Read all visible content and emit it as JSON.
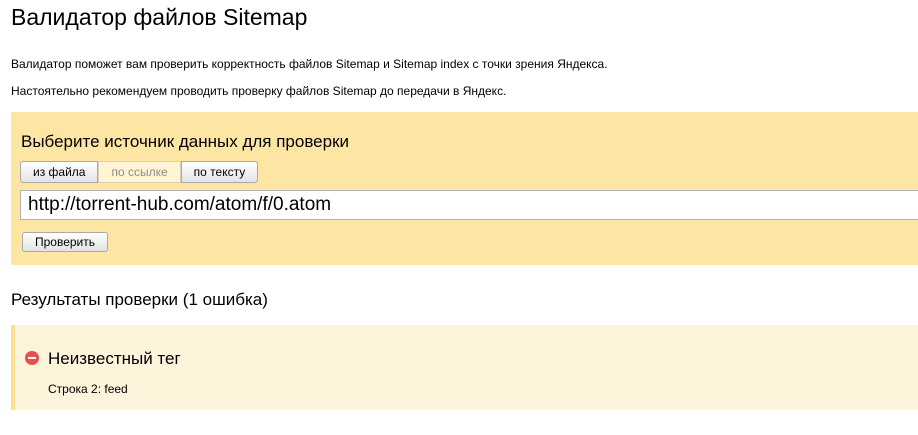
{
  "page": {
    "title": "Валидатор файлов Sitemap",
    "intro_1": "Валидатор поможет вам проверить корректность файлов Sitemap и Sitemap index с точки зрения Яндекса.",
    "intro_2": "Настоятельно рекомендуем проводить проверку файлов Sitemap до передачи в Яндекс."
  },
  "source": {
    "title": "Выберите источник данных для проверки",
    "tabs": [
      {
        "label": "из файла",
        "active": false
      },
      {
        "label": "по ссылке",
        "active": true
      },
      {
        "label": "по тексту",
        "active": false
      }
    ],
    "url_value": "http://torrent-hub.com/atom/f/0.atom",
    "check_label": "Проверить"
  },
  "results": {
    "title": "Результаты проверки (1 ошибка)",
    "errors": [
      {
        "title": "Неизвестный тег",
        "detail": "Строка 2: feed",
        "icon": "error-minus-circle-icon"
      }
    ]
  },
  "colors": {
    "panel_background": "#fde5a4",
    "result_background": "#fef3db",
    "error_icon": "#e8504f"
  }
}
